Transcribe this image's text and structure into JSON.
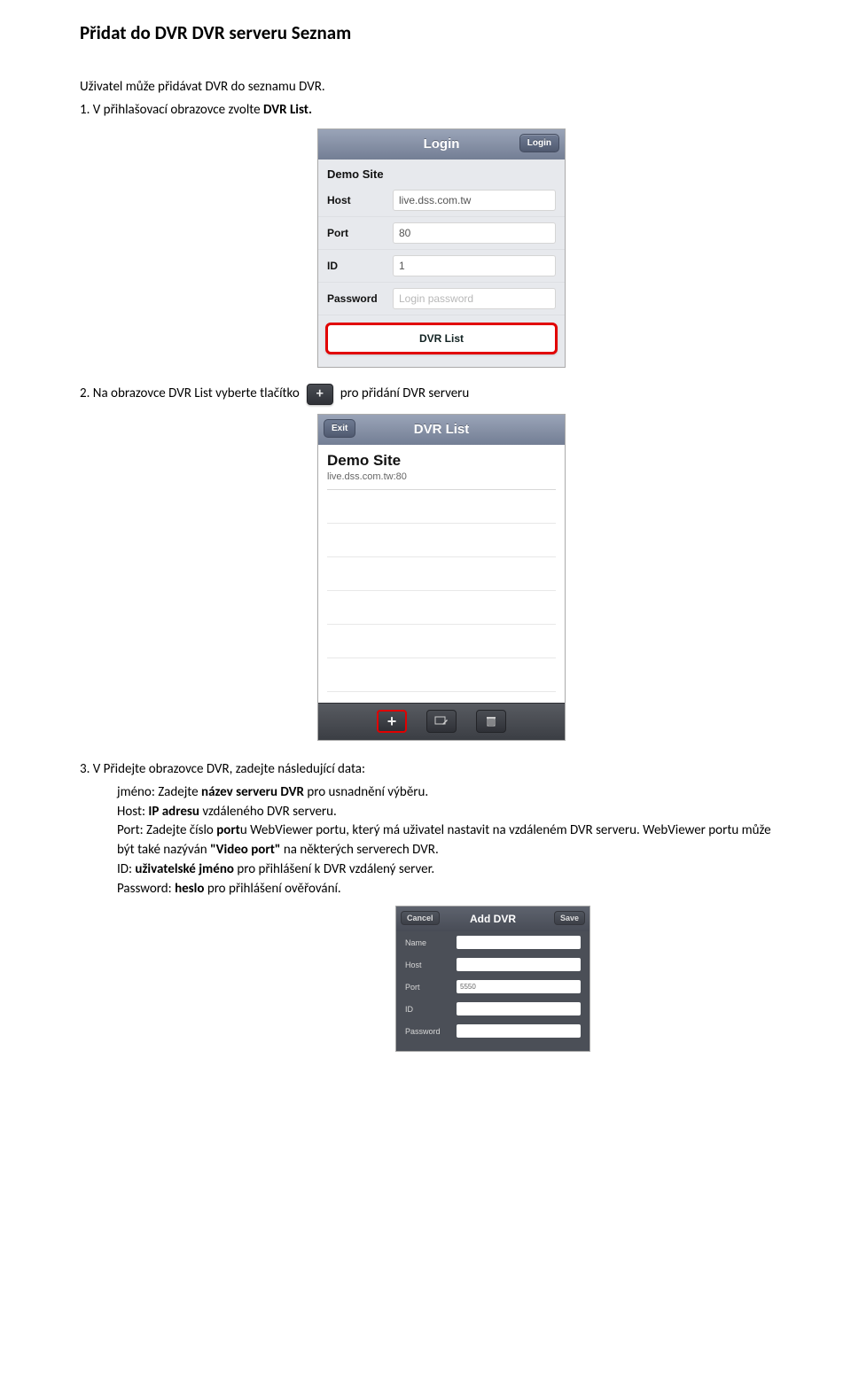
{
  "doc": {
    "title": "Přidat do DVR DVR serveru Seznam",
    "intro": "Uživatel může přidávat DVR do seznamu DVR.",
    "step1_prefix": "1. V přihlašovací obrazovce zvolte ",
    "step1_bold": "DVR List.",
    "step2_prefix": "2. Na obrazovce DVR List vyberte tlačítko ",
    "step2_suffix": " pro přidání DVR serveru",
    "step3": "3. V Přidejte obrazovce DVR, zadejte následující data:",
    "p_name_a": "jméno: Zadejte ",
    "p_name_b": "název serveru DVR",
    "p_name_c": " pro usnadnění výběru.",
    "p_host_a": "Host: ",
    "p_host_b": "IP adresu",
    "p_host_c": " vzdáleného DVR serveru.",
    "p_port_a": "Port: Zadejte číslo ",
    "p_port_b": "port",
    "p_port_c": "u WebViewer portu, který má uživatel nastavit na vzdáleném DVR serveru. WebViewer portu může být také nazýván ",
    "p_port_d": "\"Video port\"",
    "p_port_e": " na některých serverech DVR.",
    "p_id_a": "ID: ",
    "p_id_b": "uživatelské jméno",
    "p_id_c": " pro přihlášení k DVR vzdálený server.",
    "p_pw_a": "Password: ",
    "p_pw_b": "heslo",
    "p_pw_c": " pro přihlášení ověřování."
  },
  "login": {
    "header_title": "Login",
    "header_btn": "Login",
    "demo_title": "Demo Site",
    "rows": {
      "host_label": "Host",
      "host_val": "live.dss.com.tw",
      "port_label": "Port",
      "port_val": "80",
      "id_label": "ID",
      "id_val": "1",
      "pw_label": "Password",
      "pw_placeholder": "Login password"
    },
    "dvr_list_btn": "DVR List"
  },
  "list": {
    "header_title": "DVR List",
    "exit_btn": "Exit",
    "item_title": "Demo Site",
    "item_sub": "live.dss.com.tw:80"
  },
  "add": {
    "header_title": "Add DVR",
    "cancel": "Cancel",
    "save": "Save",
    "name_label": "Name",
    "host_label": "Host",
    "port_label": "Port",
    "port_value": "5550",
    "id_label": "ID",
    "pw_label": "Password"
  },
  "icons": {
    "plus": "+"
  }
}
